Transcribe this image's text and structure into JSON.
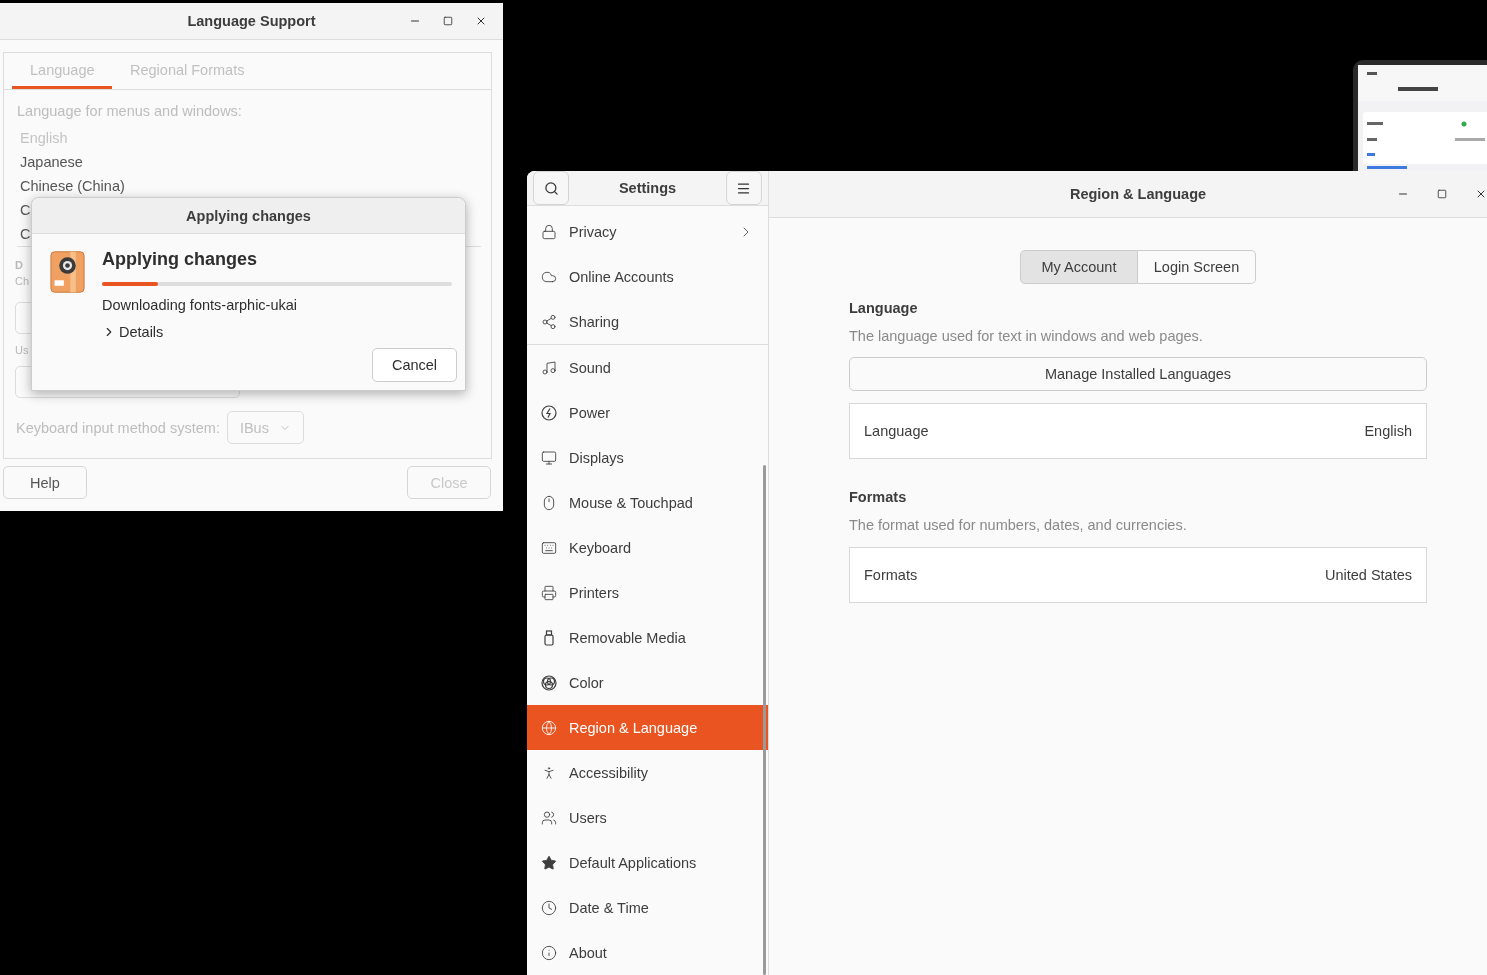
{
  "language_support": {
    "title": "Language Support",
    "tabs": [
      {
        "label": "Language",
        "selected": true
      },
      {
        "label": "Regional Formats",
        "selected": false
      }
    ],
    "languages_label": "Language for menus and windows:",
    "languages": [
      {
        "label": "English",
        "dimmed": true
      },
      {
        "label": "Japanese",
        "dimmed": false
      },
      {
        "label": "Chinese (China)",
        "dimmed": false
      },
      {
        "label": "C",
        "dimmed": false
      },
      {
        "label": "C",
        "dimmed": false
      }
    ],
    "section_heading": "D",
    "section_text": "Ch",
    "usage_label": "Us",
    "input_method_label": "Keyboard input method system:",
    "input_method": "IBus",
    "buttons": [
      {
        "label": "Help",
        "disabled": false
      },
      {
        "label": "Close",
        "disabled": true
      }
    ]
  },
  "progress_dialog": {
    "title": "Applying changes",
    "heading": "Applying changes",
    "level": 0.16,
    "status": "Downloading fonts-arphic-ukai",
    "details": {
      "label": "Details",
      "expanded": false
    },
    "cancel": "Cancel"
  },
  "settings": {
    "sidebar_title": "Settings",
    "title": "Region & Language",
    "sidebar": {
      "groups": [
        {
          "items": [
            {
              "label": "Privacy",
              "selected": false,
              "submenu": true
            },
            {
              "label": "Online Accounts",
              "selected": false,
              "submenu": false
            },
            {
              "label": "Sharing",
              "selected": false,
              "submenu": false
            }
          ]
        },
        {
          "items": [
            {
              "label": "Sound",
              "selected": false,
              "submenu": false
            },
            {
              "label": "Power",
              "selected": false,
              "submenu": false
            },
            {
              "label": "Displays",
              "selected": false,
              "submenu": false
            },
            {
              "label": "Mouse & Touchpad",
              "selected": false,
              "submenu": false
            },
            {
              "label": "Keyboard",
              "selected": false,
              "submenu": false
            },
            {
              "label": "Printers",
              "selected": false,
              "submenu": false
            },
            {
              "label": "Removable Media",
              "selected": false,
              "submenu": false
            },
            {
              "label": "Color",
              "selected": false,
              "submenu": false
            },
            {
              "label": "Region & Language",
              "selected": true,
              "submenu": false
            },
            {
              "label": "Accessibility",
              "selected": false,
              "submenu": false
            },
            {
              "label": "Users",
              "selected": false,
              "submenu": false
            },
            {
              "label": "Default Applications",
              "selected": false,
              "submenu": false
            },
            {
              "label": "Date & Time",
              "selected": false,
              "submenu": false
            },
            {
              "label": "About",
              "selected": false,
              "submenu": false
            }
          ]
        }
      ]
    },
    "account_tabs": [
      {
        "label": "My Account",
        "selected": true
      },
      {
        "label": "Login Screen",
        "selected": false
      }
    ],
    "sections": [
      {
        "heading": "Language",
        "description": "The language used for text in windows and web pages.",
        "button": "Manage Installed Languages",
        "rows": [
          {
            "label": "Language",
            "value": "English"
          }
        ]
      },
      {
        "heading": "Formats",
        "description": "The format used for numbers, dates, and currencies.",
        "rows": [
          {
            "label": "Formats",
            "value": "United States"
          }
        ]
      }
    ]
  }
}
